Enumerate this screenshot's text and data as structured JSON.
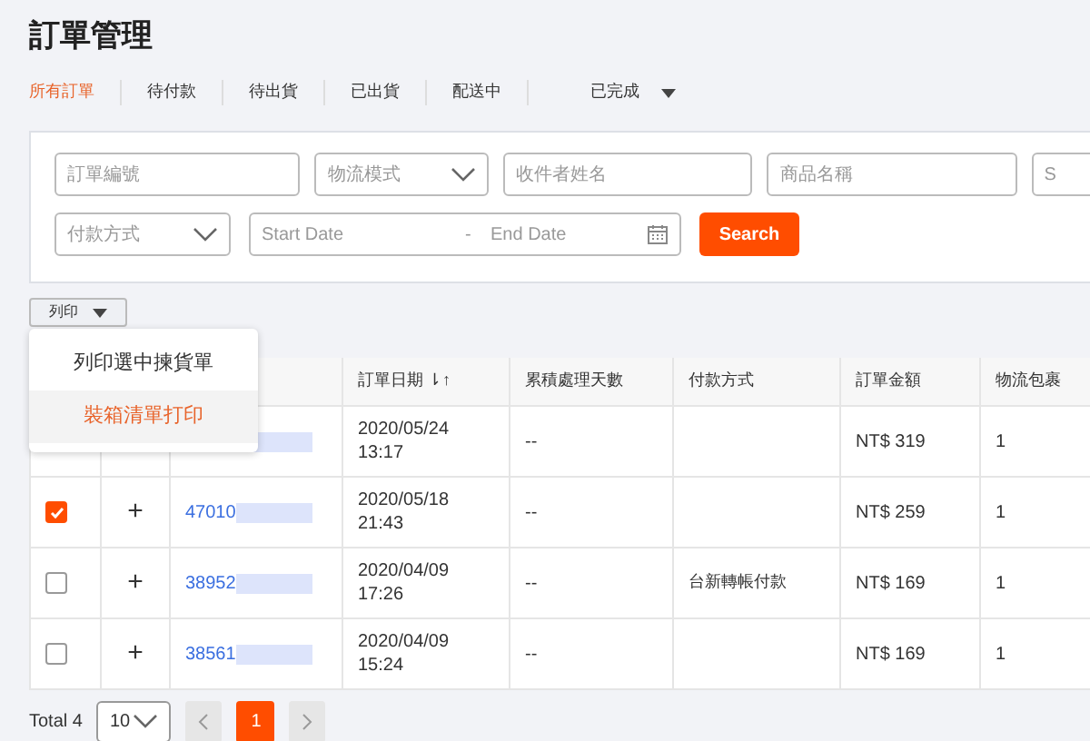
{
  "page_title": "訂單管理",
  "status_tabs": [
    {
      "label": "所有訂單",
      "selected": true
    },
    {
      "label": "待付款",
      "selected": false
    },
    {
      "label": "待出貨",
      "selected": false
    },
    {
      "label": "已出貨",
      "selected": false
    },
    {
      "label": "配送中",
      "selected": false
    },
    {
      "label": "已完成",
      "selected": false,
      "dropdown": true
    }
  ],
  "filters": [
    {
      "kind": "text",
      "placeholder": "訂單編號"
    },
    {
      "kind": "select",
      "placeholder": "物流模式"
    },
    {
      "kind": "text",
      "placeholder": "收件者姓名"
    },
    {
      "kind": "text",
      "placeholder": "商品名稱"
    },
    {
      "kind": "text",
      "placeholder": "S"
    }
  ],
  "filters_row_2": {
    "payment": {
      "placeholder": "付款方式"
    },
    "date_range": {
      "start_placeholder": "Start Date",
      "separator": "-",
      "end_placeholder": "End Date"
    },
    "search_button": "Search"
  },
  "print_button": "列印",
  "print_menu": [
    {
      "label": "列印選中揀貨單",
      "highlighted": false
    },
    {
      "label": "裝箱清單打印",
      "highlighted": true
    }
  ],
  "table": {
    "columns": [
      "訂單日期 ⇂↑",
      "累積處理天數",
      "付款方式",
      "訂單金額",
      "物流包裹"
    ],
    "rows": [
      {
        "order_no": "",
        "date": "2020/05/24",
        "time": "13:17",
        "days": "--",
        "payment": "",
        "amount": "NT$ 319",
        "packages": "1"
      },
      {
        "checked": true,
        "expand": "+",
        "order_no": "47010",
        "date": "2020/05/18",
        "time": "21:43",
        "days": "--",
        "payment": "",
        "amount": "NT$ 259",
        "packages": "1"
      },
      {
        "checked": false,
        "expand": "+",
        "order_no": "38952",
        "date": "2020/04/09",
        "time": "17:26",
        "days": "--",
        "payment": "台新轉帳付款",
        "amount": "NT$ 169",
        "packages": "1"
      },
      {
        "checked": false,
        "expand": "+",
        "order_no": "38561",
        "date": "2020/04/09",
        "time": "15:24",
        "days": "--",
        "payment": "",
        "amount": "NT$ 169",
        "packages": "1"
      }
    ]
  },
  "pagination": {
    "total": "Total 4",
    "page_size": "10",
    "pages": [
      {
        "label": "1",
        "selected": true
      }
    ]
  }
}
